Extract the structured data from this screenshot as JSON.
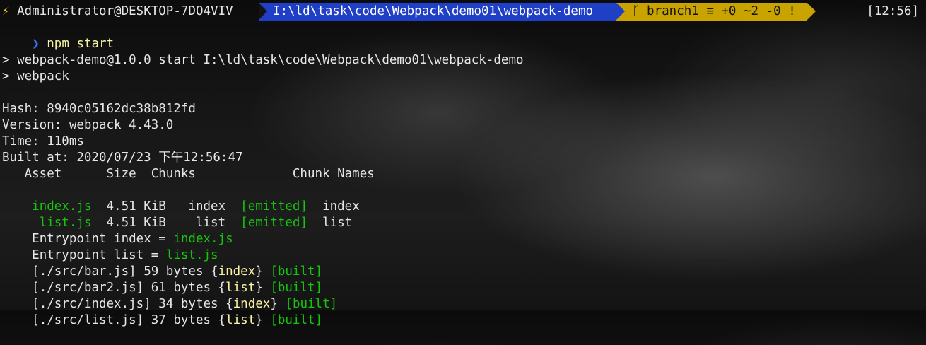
{
  "prompt": {
    "bolt": "⚡",
    "user_host": "Administrator@DESKTOP-7DO4VIV",
    "path": "I:\\ld\\task\\code\\Webpack\\demo01\\webpack-demo",
    "git": "ᚴ branch1 ≡ +0 ~2 -0 !",
    "time": "[12:56]",
    "chevron": "❯",
    "command": "npm start"
  },
  "npm_output": {
    "line1": "> webpack-demo@1.0.0 start I:\\ld\\task\\code\\Webpack\\demo01\\webpack-demo",
    "line2": "> webpack"
  },
  "build": {
    "hash": "Hash: 8940c05162dc38b812fd",
    "version": "Version: webpack 4.43.0",
    "time": "Time: 110ms",
    "built_at": "Built at: 2020/07/23 下午12:56:47",
    "table_header": "   Asset      Size  Chunks             Chunk Names",
    "assets": [
      {
        "asset": "index.js",
        "size": "  4.51 KiB   index  ",
        "status": "[emitted]",
        "names": "  index"
      },
      {
        "asset": " list.js",
        "size": "  4.51 KiB    list  ",
        "status": "[emitted]",
        "names": "  list"
      }
    ],
    "entrypoints": [
      {
        "label": "Entrypoint index = ",
        "file": "index.js"
      },
      {
        "label": "Entrypoint list = ",
        "file": "list.js"
      }
    ],
    "modules": [
      {
        "path": "[./src/bar.js] 59 bytes {",
        "chunk": "index",
        "close": "} ",
        "status": "[built]"
      },
      {
        "path": "[./src/bar2.js] 61 bytes {",
        "chunk": "list",
        "close": "} ",
        "status": "[built]"
      },
      {
        "path": "[./src/index.js] 34 bytes {",
        "chunk": "index",
        "close": "} ",
        "status": "[built]"
      },
      {
        "path": "[./src/list.js] 37 bytes {",
        "chunk": "list",
        "close": "} ",
        "status": "[built]"
      }
    ]
  }
}
